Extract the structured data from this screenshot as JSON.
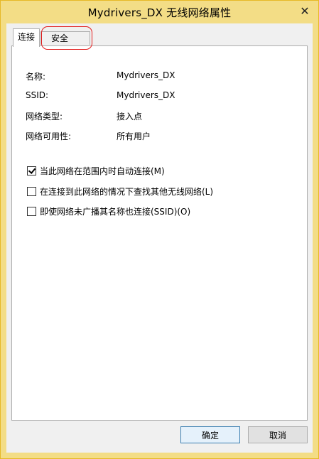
{
  "window": {
    "title": "Mydrivers_DX 无线网络属性",
    "close_glyph": "✕"
  },
  "tabs": {
    "connect": "连接",
    "security": "安全"
  },
  "properties": [
    {
      "label": "名称:",
      "value": "Mydrivers_DX"
    },
    {
      "label": "SSID:",
      "value": "Mydrivers_DX"
    },
    {
      "label": "网络类型:",
      "value": "接入点"
    },
    {
      "label": "网络可用性:",
      "value": "所有用户"
    }
  ],
  "options": [
    {
      "label": "当此网络在范围内时自动连接(M)",
      "checked": true
    },
    {
      "label": "在连接到此网络的情况下查找其他无线网络(L)",
      "checked": false
    },
    {
      "label": "即使网络未广播其名称也连接(SSID)(O)",
      "checked": false
    }
  ],
  "buttons": {
    "ok": "确定",
    "cancel": "取消"
  },
  "colors": {
    "frame": "#f3dd86",
    "highlight": "#e31b1b"
  }
}
